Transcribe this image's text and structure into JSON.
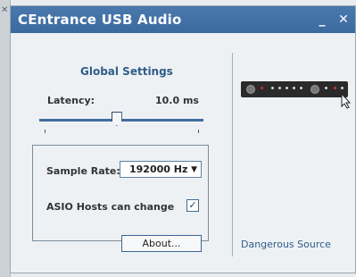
{
  "window": {
    "title": "CEntrance USB Audio"
  },
  "titlebar": {
    "minimize_glyph": "_",
    "close_glyph": "✕"
  },
  "settings": {
    "title": "Global Settings",
    "latency_label": "Latency:",
    "latency_value": "10.0 ms",
    "latency_fraction": 0.47,
    "sample_rate_label": "Sample Rate:",
    "sample_rate_value": "192000 Hz",
    "asio_label": "ASIO Hosts can change",
    "asio_checked": true
  },
  "about_label": "About...",
  "brand_link": "Dangerous Source",
  "colors": {
    "accent": "#3b6aa0",
    "text": "#333333"
  },
  "icons": {
    "minimize": "minimize-icon",
    "close": "close-icon",
    "check": "checkmark-icon",
    "dropdown": "chevron-down-icon",
    "cursor": "cursor-icon"
  }
}
